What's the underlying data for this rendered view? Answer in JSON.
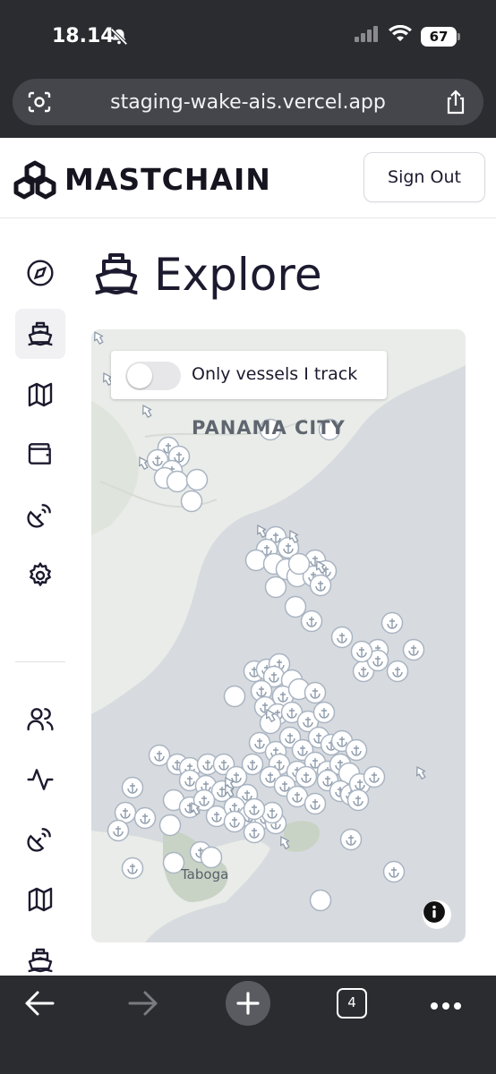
{
  "status": {
    "time": "18.14",
    "battery": "67"
  },
  "browser": {
    "url": "staging-wake-ais.vercel.app",
    "tab_count": "4"
  },
  "header": {
    "brand": "MASTCHAIN",
    "sign_out": "Sign Out"
  },
  "sidebar": {
    "items": [
      {
        "icon": "compass-icon",
        "active": false
      },
      {
        "icon": "ship-icon",
        "active": true
      },
      {
        "icon": "map-icon",
        "active": false
      },
      {
        "icon": "wallet-icon",
        "active": false
      },
      {
        "icon": "satellite-dish-icon",
        "active": false
      },
      {
        "icon": "gear-icon",
        "active": false
      },
      {
        "icon": "users-icon",
        "active": false
      },
      {
        "icon": "activity-icon",
        "active": false
      },
      {
        "icon": "satellite-dish-icon",
        "active": false
      },
      {
        "icon": "map-icon",
        "active": false
      },
      {
        "icon": "ship-icon",
        "active": false
      }
    ]
  },
  "page": {
    "title": "Explore"
  },
  "map": {
    "toggle_label": "Only vessels I track",
    "toggle_on": false,
    "city_label": "PANAMA CITY",
    "island_label": "Taboga",
    "marker_icon": "anchor-icon"
  },
  "colors": {
    "chrome": "#2b2c30",
    "text": "#1c1a2e",
    "water": "#d7dbdf",
    "land": "#e9ece8",
    "marker_fill": "#ffffff",
    "marker_stroke": "#a9b4c2"
  }
}
